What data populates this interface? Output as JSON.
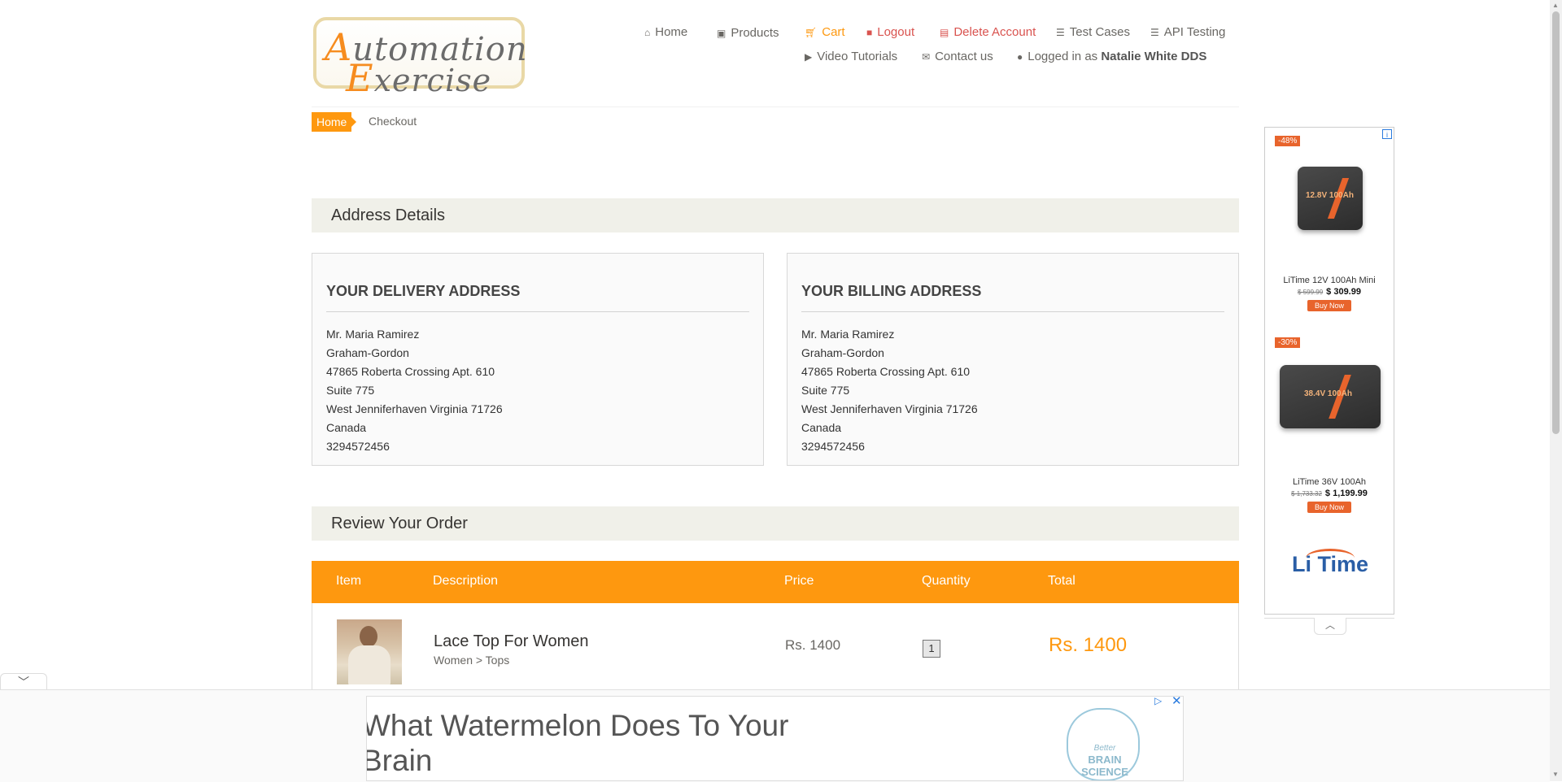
{
  "logo": {
    "line1_cap": "A",
    "line1_rest": "utomation",
    "line2_cap": "E",
    "line2_rest": "xercise"
  },
  "nav": {
    "home": {
      "icon": "home-icon",
      "label": "Home"
    },
    "products": {
      "icon": "briefcase-icon",
      "label": "Products"
    },
    "cart": {
      "icon": "cart-icon",
      "label": "Cart"
    },
    "logout": {
      "icon": "lock-icon",
      "label": "Logout"
    },
    "delete_account": {
      "icon": "trash-icon",
      "label": "Delete Account"
    },
    "test_cases": {
      "icon": "list-icon",
      "label": "Test Cases"
    },
    "api_testing": {
      "icon": "list-icon",
      "label": "API Testing"
    },
    "video_tutorials": {
      "icon": "youtube-icon",
      "label": "Video Tutorials"
    },
    "contact_us": {
      "icon": "envelope-icon",
      "label": "Contact us"
    },
    "logged_in_prefix": "Logged in as",
    "logged_in_user": "Natalie White DDS"
  },
  "breadcrumb": {
    "home": "Home",
    "current": "Checkout"
  },
  "address_section": {
    "title": "Address Details",
    "delivery": {
      "heading": "Your delivery address",
      "lines": [
        "Mr. Maria Ramirez",
        "Graham-Gordon",
        "47865 Roberta Crossing Apt. 610",
        "Suite 775",
        "West Jenniferhaven Virginia 71726",
        "Canada",
        "3294572456"
      ]
    },
    "billing": {
      "heading": "Your billing address",
      "lines": [
        "Mr. Maria Ramirez",
        "Graham-Gordon",
        "47865 Roberta Crossing Apt. 610",
        "Suite 775",
        "West Jenniferhaven Virginia 71726",
        "Canada",
        "3294572456"
      ]
    }
  },
  "order_section": {
    "title": "Review Your Order",
    "columns": [
      "Item",
      "Description",
      "Price",
      "Quantity",
      "Total"
    ],
    "rows": [
      {
        "name": "Lace Top For Women",
        "category": "Women > Tops",
        "price": "Rs. 1400",
        "quantity": "1",
        "total": "Rs. 1400"
      }
    ]
  },
  "side_ad": {
    "products": [
      {
        "discount": "-48%",
        "title": "LiTime 12V 100Ah Mini",
        "old_price": "$ 599.99",
        "price": "$ 309.99",
        "cta": "Buy Now",
        "battery_label": "12.8V 100Ah"
      },
      {
        "discount": "-30%",
        "title": "LiTime 36V 100Ah",
        "old_price": "$ 1,733.32",
        "price": "$ 1,199.99",
        "cta": "Buy Now",
        "battery_label": "38.4V 100Ah"
      }
    ],
    "brand": "Li Time"
  },
  "bottom_ad": {
    "headline": "What Watermelon Does To Your Brain",
    "brand_small": "Better",
    "brand_main": "BRAIN SCIENCE"
  },
  "colors": {
    "accent": "#fe980f",
    "danger": "#d9534f",
    "section_bg": "#f0f0e9"
  }
}
